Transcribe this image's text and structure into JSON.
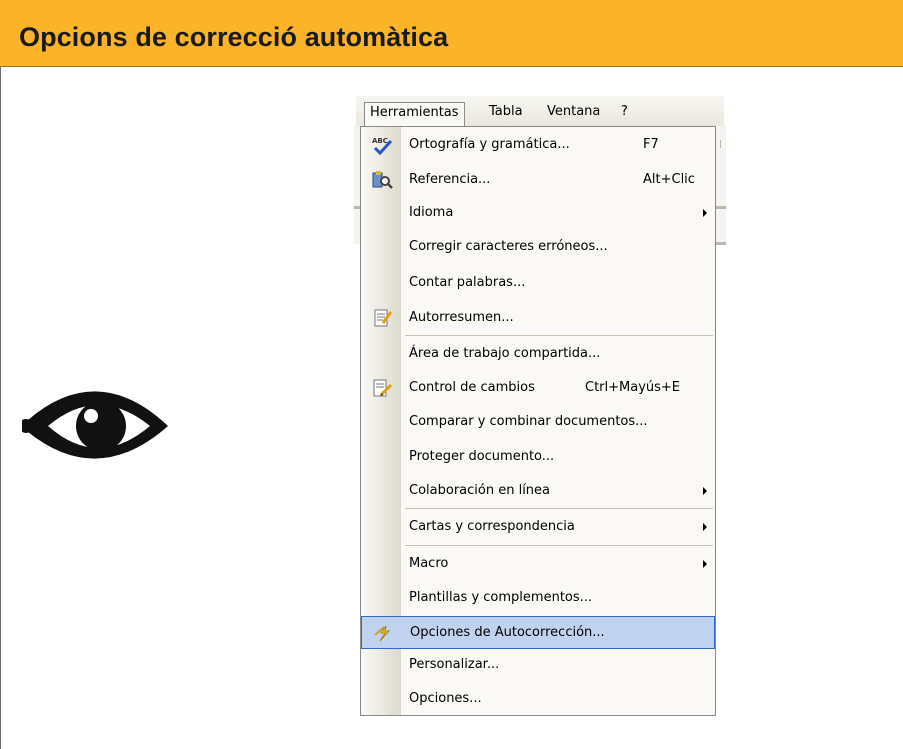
{
  "slide": {
    "title": "Opcions de correcció automàtica"
  },
  "menubar": {
    "items": [
      "Herramientas",
      "Tabla",
      "Ventana",
      "?"
    ]
  },
  "menu": {
    "items": [
      {
        "label": "Ortografía y gramática...",
        "shortcut": "F7",
        "icon": "spellcheck-icon"
      },
      {
        "label": "Referencia...",
        "shortcut": "Alt+Clic",
        "icon": "research-icon"
      },
      {
        "label": "Idioma",
        "submenu": true
      },
      {
        "label": "Corregir caracteres erróneos..."
      },
      {
        "label": "Contar palabras..."
      },
      {
        "label": "Autorresumen...",
        "icon": "autosummary-icon"
      },
      {
        "label": "Área de trabajo compartida..."
      },
      {
        "label": "Control de cambios",
        "shortcut": "Ctrl+Mayús+E",
        "icon": "track-changes-icon"
      },
      {
        "label": "Comparar y combinar documentos..."
      },
      {
        "label": "Proteger documento..."
      },
      {
        "label": "Colaboración en línea",
        "submenu": true
      },
      {
        "label": "Cartas y correspondencia",
        "submenu": true
      },
      {
        "label": "Macro",
        "submenu": true
      },
      {
        "label": "Plantillas y complementos..."
      },
      {
        "label": "Opciones de Autocorrección...",
        "icon": "autocorrect-icon",
        "highlighted": true
      },
      {
        "label": "Personalizar..."
      },
      {
        "label": "Opciones..."
      }
    ]
  },
  "colors": {
    "header": "#fbb328",
    "highlight_fill": "#c1d2ee",
    "highlight_border": "#316ac5"
  }
}
